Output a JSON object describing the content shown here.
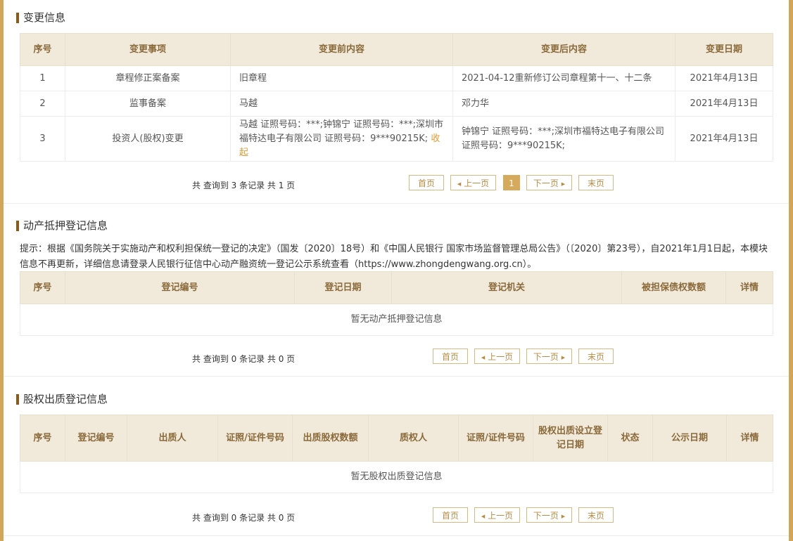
{
  "change": {
    "title": "变更信息",
    "headers": [
      "序号",
      "变更事项",
      "变更前内容",
      "变更后内容",
      "变更日期"
    ],
    "rows": [
      {
        "no": "1",
        "item": "章程修正案备案",
        "before": "旧章程",
        "after": "2021-04-12重新修订公司章程第十一、十二条",
        "date": "2021年4月13日"
      },
      {
        "no": "2",
        "item": "监事备案",
        "before": "马越",
        "after": "邓力华",
        "date": "2021年4月13日"
      },
      {
        "no": "3",
        "item": "投资人(股权)变更",
        "before": "马越 证照号码：***;钟锦宁 证照号码：***;深圳市福特达电子有限公司 证照号码：9***90215K;",
        "before_toggle": "收起",
        "after": "钟锦宁 证照号码：***;深圳市福特达电子有限公司 证照号码：9***90215K;",
        "date": "2021年4月13日"
      }
    ],
    "pager": {
      "summary": "共 查询到 3 条记录 共 1 页",
      "first": "首页",
      "prev": "上一页",
      "current": "1",
      "next": "下一页",
      "last": "末页"
    }
  },
  "mortgage": {
    "title": "动产抵押登记信息",
    "hint": "提示：根据《国务院关于实施动产和权利担保统一登记的决定》（国发〔2020〕18号）和《中国人民银行 国家市场监督管理总局公告》（〔2020〕第23号），自2021年1月1日起，本模块信息不再更新，详细信息请登录人民银行征信中心动产融资统一登记公示系统查看（https://www.zhongdengwang.org.cn）。",
    "headers": [
      "序号",
      "登记编号",
      "登记日期",
      "登记机关",
      "被担保债权数额",
      "详情"
    ],
    "empty": "暂无动产抵押登记信息",
    "pager": {
      "summary": "共 查询到 0 条记录 共 0 页",
      "first": "首页",
      "prev": "上一页",
      "next": "下一页",
      "last": "末页"
    }
  },
  "pledge": {
    "title": "股权出质登记信息",
    "headers": [
      "序号",
      "登记编号",
      "出质人",
      "证照/证件号码",
      "出质股权数额",
      "质权人",
      "证照/证件号码",
      "股权出质设立登记日期",
      "状态",
      "公示日期",
      "详情"
    ],
    "empty": "暂无股权出质登记信息",
    "pager": {
      "summary": "共 查询到 0 条记录 共 0 页",
      "first": "首页",
      "prev": "上一页",
      "next": "下一页",
      "last": "末页"
    }
  },
  "colors": {
    "frame": "#d0a65a",
    "header_bg": "#f1e9d9",
    "header_text": "#8a6a3a",
    "accent": "#d6aa5c",
    "title_bar": "#8a5a1c"
  }
}
